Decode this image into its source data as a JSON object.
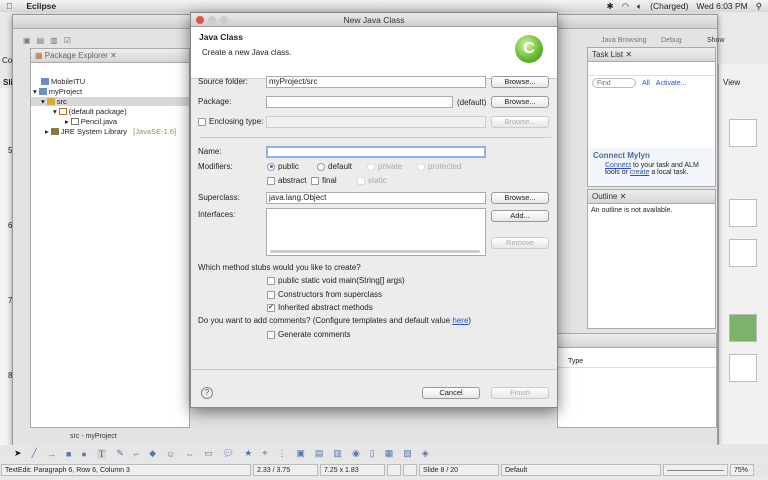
{
  "menubar": {
    "app": "Eclipse",
    "battery": "(Charged)",
    "clock": "Wed 6:03 PM"
  },
  "impress": {
    "side_tab": "Cou",
    "slides_header": "Slides",
    "slide_numbers": [
      "5",
      "6",
      "7",
      "8"
    ],
    "right_header": "View",
    "draw_tools": [
      "select",
      "line",
      "arrow",
      "rectangle",
      "ellipse",
      "text",
      "curve",
      "connector",
      "basic-shapes",
      "symbol-shapes",
      "block-arrows",
      "flowchart",
      "callouts",
      "stars",
      "points",
      "glue",
      "from-file",
      "gallery",
      "fontwork",
      "extrusion",
      "rotate",
      "align",
      "arrange",
      "shadow",
      "toggle"
    ],
    "status": {
      "edit": "TextEdit: Paragraph 6, Row 6, Column 3",
      "position": "2.33 / 3.75",
      "size": "7.25 x 1.83",
      "slide": "Slide 8 / 20",
      "layout": "Default",
      "zoom": "75%"
    }
  },
  "eclipse": {
    "perspectives": {
      "java_browsing": "Java Browsing",
      "debug": "Debug",
      "show": "Show"
    },
    "package_explorer": {
      "title": "Package Explorer",
      "tree": [
        {
          "label": "MobileITU",
          "level": 0
        },
        {
          "label": "myProject",
          "level": 0
        },
        {
          "label": "src",
          "level": 1,
          "selected": true
        },
        {
          "label": "(default package)",
          "level": 2
        },
        {
          "label": "Pencil.java",
          "level": 3
        },
        {
          "label": "JRE System Library",
          "suffix": "[JavaSE-1.6]",
          "level": 1
        }
      ]
    },
    "task_list": {
      "title": "Task List",
      "find_placeholder": "Find",
      "all": "All",
      "activate": "Activate...",
      "mylyn_title": "Connect Mylyn",
      "mylyn_connect": "Connect",
      "mylyn_text1": " to your task and ALM tools or ",
      "mylyn_create": "create",
      "mylyn_text2": " a local task."
    },
    "outline": {
      "title": "Outline",
      "message": "An outline is not available."
    },
    "bottom_view": {
      "column": "Type"
    },
    "status": "src - myProject"
  },
  "dialog": {
    "title": "New Java Class",
    "heading": "Java Class",
    "subheading": "Create a new Java class.",
    "logo_letter": "C",
    "source_folder_label": "Source folder:",
    "source_folder_value": "myProject/src",
    "package_label": "Package:",
    "package_value": "",
    "package_default": "(default)",
    "enclosing_label": "Enclosing type:",
    "enclosing_value": "",
    "browse": "Browse...",
    "name_label": "Name:",
    "name_value": "",
    "modifiers_label": "Modifiers:",
    "modifiers": {
      "public": "public",
      "default": "default",
      "private": "private",
      "protected": "protected",
      "abstract": "abstract",
      "final": "final",
      "static": "static"
    },
    "superclass_label": "Superclass:",
    "superclass_value": "java.lang.Object",
    "interfaces_label": "Interfaces:",
    "add": "Add...",
    "remove": "Remove",
    "stubs_question": "Which method stubs would you like to create?",
    "stub_main": "public static void main(String[] args)",
    "stub_constructors": "Constructors from superclass",
    "stub_inherited": "Inherited abstract methods",
    "comments_question": "Do you want to add comments? (Configure templates and default value ",
    "comments_link": "here",
    "comments_close": ")",
    "generate_comments": "Generate comments",
    "cancel": "Cancel",
    "finish": "Finish",
    "checked": {
      "main": false,
      "constructors": false,
      "inherited": true,
      "comments": false,
      "abstract": false,
      "final": false,
      "enclosing": false
    },
    "selected_modifier": "public"
  }
}
